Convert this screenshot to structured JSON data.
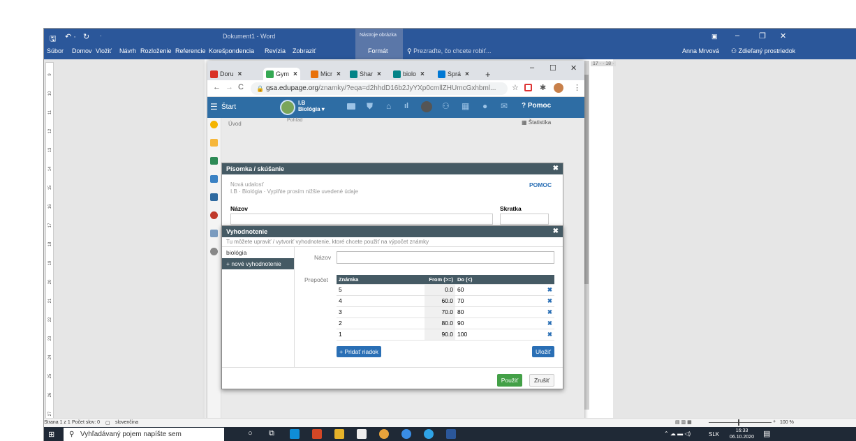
{
  "word": {
    "doc_title": "Dokument1 - Word",
    "context_group": "Nástroje obrázka",
    "tabs": [
      "Súbor",
      "Domov",
      "Vložiť",
      "Návrh",
      "Rozloženie",
      "Referencie",
      "Korešpondencia",
      "Revízia",
      "Zobraziť",
      "Formát"
    ],
    "tell_me": "Prezraďte, čo chcete robiť...",
    "user": "Anna Mrvová",
    "share": "Zdieľaný prostriedok",
    "ruler_marks": [
      "9",
      "10",
      "11",
      "12",
      "13",
      "14",
      "15",
      "16",
      "17",
      "18",
      "19",
      "20",
      "21",
      "22",
      "23",
      "24",
      "25",
      "26",
      "27"
    ],
    "ruler_top_right": "17 · · 18 ·",
    "status": {
      "page": "Strana 1 z 1",
      "words": "Počet slov: 0",
      "lang": "slovenčina",
      "zoom": "100 %"
    }
  },
  "browser": {
    "tabs": [
      {
        "label": "Doru",
        "color": "#d93025"
      },
      {
        "label": "Gym",
        "color": "#34a853",
        "active": true
      },
      {
        "label": "Micr",
        "color": "#e8710a"
      },
      {
        "label": "Shar",
        "color": "#038387"
      },
      {
        "label": "biolo",
        "color": "#038387"
      },
      {
        "label": "Sprá",
        "color": "#0078d4"
      }
    ],
    "url_host": "gsa.edupage.org",
    "url_path": "/znamky/?eqa=d2hhdD16b2JyYXp0cmllZHUmcGxhbml..."
  },
  "edupage": {
    "start": "Štart",
    "class_label": "I.B",
    "subject": "Biológia",
    "help": "Pomoc",
    "row2_left": "Úvod",
    "row2_mid": "Pohľad",
    "row2_right": "Štatistika"
  },
  "dialog_test": {
    "title": "Písomka / skúšanie",
    "help": "POMOC",
    "event_new": "Nová udalosť",
    "event_sub": "I.B · Biológia · Vyplňte prosím nižšie uvedené údaje",
    "name_label": "Názov",
    "abbr_label": "Skratka"
  },
  "dialog_eval": {
    "title": "Vyhodnotenie",
    "hint": "Tu môžete upraviť / vytvoriť vyhodnotenie, ktoré chcete použiť na výpočet známky",
    "list": [
      "biológia",
      "+ nové vyhodnotenie"
    ],
    "name_label": "Názov",
    "name_value": "",
    "calc_label": "Prepočet",
    "columns": [
      "Známka",
      "From (>=)",
      "Do (<)"
    ],
    "rows": [
      {
        "grade": "5",
        "from": "0.0",
        "to": "60"
      },
      {
        "grade": "4",
        "from": "60.0",
        "to": "70"
      },
      {
        "grade": "3",
        "from": "70.0",
        "to": "80"
      },
      {
        "grade": "2",
        "from": "80.0",
        "to": "90"
      },
      {
        "grade": "1",
        "from": "90.0",
        "to": "100"
      }
    ],
    "add_row": "+ Pridať riadok",
    "save": "Uložiť",
    "apply": "Použiť",
    "cancel": "Zrušiť"
  },
  "taskbar": {
    "search_placeholder": "Vyhľadávaný pojem napíšte sem",
    "lang": "SLK",
    "time": "16:33",
    "date": "06.10.2020"
  }
}
